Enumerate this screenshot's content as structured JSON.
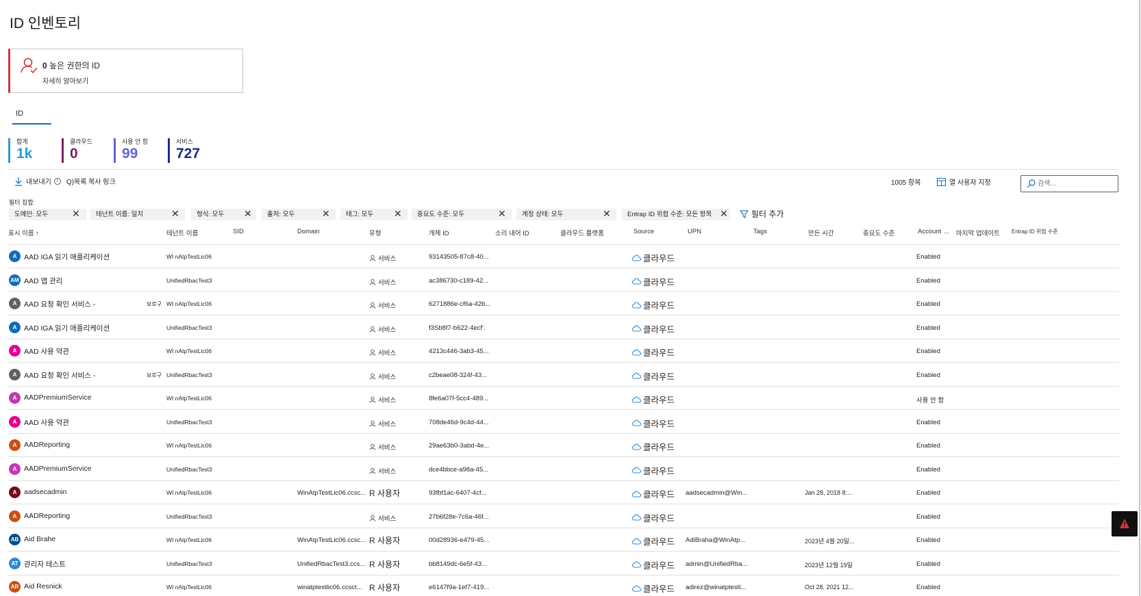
{
  "page": {
    "title": "ID 인벤토리"
  },
  "alert_card": {
    "count": "0",
    "title": "높은 권한의 ID",
    "link": "자세히 알아보기"
  },
  "tabs": [
    {
      "label": "ID"
    }
  ],
  "kpis": [
    {
      "label": "합계",
      "value": "1k",
      "color": "#2b9ad6"
    },
    {
      "label": "클라우드",
      "value": "0",
      "color": "#7a1f63"
    },
    {
      "label": "사용 안 함",
      "value": "99",
      "color": "#6264d8"
    },
    {
      "label": "서비스",
      "value": "727",
      "color": "#1d2a86"
    }
  ],
  "toolbar": {
    "export_label": "내보내기",
    "copy_label": "Q)목록 복사 링크",
    "count": "1005 항목",
    "customize_columns": "열 사용자 지정",
    "search_placeholder": "검색..."
  },
  "filters": {
    "label": "필터 집합:",
    "pills": [
      "도메인: 모두",
      "테넌트 이름: 일치",
      "형식: 모두",
      "출처: 모두",
      "태그: 모두",
      "중요도 수준: 모두",
      "계정 상태: 모두",
      "Entrap ID 위험 수준: 모든 항목"
    ],
    "add_label": "필터 추가"
  },
  "columns": [
    "표시 이름 ↑",
    "테넌트 이름",
    "SID",
    "Domain",
    "유형",
    "개체 ID",
    "소리 내어 ID",
    "클라우드 플랫폼",
    "Source",
    "UPN",
    "Tags",
    "만든 시간",
    "중요도 수준",
    "Account",
    "...",
    "마지막 업데이트",
    "Entrap ID 위험 수준"
  ],
  "rows": [
    {
      "initials": "A",
      "avatar_color": "#0f6cbd",
      "name": "AAD IGA 읽기 애플리케이션",
      "brand": "",
      "tenant": "WI nAtpTestLic06",
      "domain": "",
      "type": "서비스",
      "type_kind": "service",
      "objid": "93143505-87c8-40...",
      "source": "클라우드",
      "upn": "",
      "created": "",
      "account": "Enabled"
    },
    {
      "initials": "AM",
      "avatar_color": "#0f6cbd",
      "name": "AAD 앱 관리",
      "brand": "",
      "tenant": "UnifiedRbacTest3",
      "domain": "",
      "type": "서비스",
      "type_kind": "service",
      "objid": "ac386730-c189-42...",
      "source": "클라우드",
      "upn": "",
      "created": "",
      "account": "Enabled"
    },
    {
      "initials": "A",
      "avatar_color": "#616161",
      "name": "AAD 요청 확인 서비스 -",
      "brand": "보로구",
      "tenant": "WI nAtpTestLic06",
      "domain": "",
      "type": "서비스",
      "type_kind": "service",
      "objid": "6271886e-cf6a-42b...",
      "source": "클라우드",
      "upn": "",
      "created": "",
      "account": "Enabled"
    },
    {
      "initials": "A",
      "avatar_color": "#0f6cbd",
      "name": "AAD IGA 읽기 애플리케이션",
      "brand": "",
      "tenant": "UnifiedRbacTest3",
      "domain": "",
      "type": "서비스",
      "type_kind": "service",
      "objid": "f3Sb8f7-b622-4ecf'.",
      "source": "클라우드",
      "upn": "",
      "created": "",
      "account": "Enabled"
    },
    {
      "initials": "A",
      "avatar_color": "#e3008c",
      "name": "AAD 사용 약관",
      "brand": "",
      "tenant": "WI nAtpTestLic06",
      "domain": "",
      "type": "서비스",
      "type_kind": "service",
      "objid": "4213c446-3ab3-45...",
      "source": "클라우드",
      "upn": "",
      "created": "",
      "account": "Enabled"
    },
    {
      "initials": "A",
      "avatar_color": "#616161",
      "name": "AAD 요청 확인 서비스 -",
      "brand": "보로구",
      "tenant": "UnifiedRbacTest3",
      "domain": "",
      "type": "서비스",
      "type_kind": "service",
      "objid": "c2beae08-324f-43...",
      "source": "클라우드",
      "upn": "",
      "created": "",
      "account": "Enabled"
    },
    {
      "initials": "A",
      "avatar_color": "#c239b3",
      "name": "AADPremiumService",
      "brand": "",
      "tenant": "WI nAtpTestLic06",
      "domain": "",
      "type": "서비스",
      "type_kind": "service",
      "objid": "8fe6a07f-5cc4-489...",
      "source": "클라우드",
      "upn": "",
      "created": "",
      "account": "사용 안 함"
    },
    {
      "initials": "A",
      "avatar_color": "#e3008c",
      "name": "AAD 사용 약관",
      "brand": "",
      "tenant": "UnifiedRbacTest3",
      "domain": "",
      "type": "서비스",
      "type_kind": "service",
      "objid": "708de46d-9c4d-44...",
      "source": "클라우드",
      "upn": "",
      "created": "",
      "account": "Enabled"
    },
    {
      "initials": "A",
      "avatar_color": "#ca5010",
      "name": "AADReporting",
      "brand": "",
      "tenant": "WI nAtpTestLic06",
      "domain": "",
      "type": "서비스",
      "type_kind": "service",
      "objid": "29ae63b0-3abd-4e...",
      "source": "클라우드",
      "upn": "",
      "created": "",
      "account": "Enabled"
    },
    {
      "initials": "A",
      "avatar_color": "#c239b3",
      "name": "AADPremiumService",
      "brand": "",
      "tenant": "UnifiedRbacTest3",
      "domain": "",
      "type": "서비스",
      "type_kind": "service",
      "objid": "dce4bbce-a98a-45...",
      "source": "클라우드",
      "upn": "",
      "created": "",
      "account": "Enabled"
    },
    {
      "initials": "A",
      "avatar_color": "#750b1c",
      "name": "aadsecadmin",
      "brand": "",
      "tenant": "WI nAtpTestLic06",
      "domain": "WinAtpTestLic06.ccsc...",
      "type": "R 사용자",
      "type_kind": "user",
      "objid": "93fbf1ac-6407-4cf...",
      "source": "클라우드",
      "upn": "aadsecadmin@Win...",
      "created": "Jan 28, 2018 8:...",
      "account": "Enabled"
    },
    {
      "initials": "A",
      "avatar_color": "#ca5010",
      "name": "AADReporting",
      "brand": "",
      "tenant": "UnifiedRbacTest3",
      "domain": "",
      "type": "서비스",
      "type_kind": "service",
      "objid": "27b6f28e-7c6a-46f...",
      "source": "클라우드",
      "upn": "",
      "created": "",
      "account": "Enabled"
    },
    {
      "initials": "AB",
      "avatar_color": "#004e8c",
      "name": "Aid Brahe",
      "brand": "",
      "tenant": "WI nAtpTestLic06",
      "domain": "WinAtpTestLic06.ccsc...",
      "type": "R 사용자",
      "type_kind": "user",
      "objid": "00d28936-e479-45...",
      "source": "클라우드",
      "upn": "AdiBraha@WinAtp...",
      "created": "2023년 4월 20일...",
      "account": "Enabled"
    },
    {
      "initials": "AT",
      "avatar_color": "#2b88d8",
      "name": "관리자 테스트",
      "brand": "",
      "tenant": "UnifiedRbacTest3",
      "domain": "UnifiedRbacTest3.ccs...",
      "type": "R 사용자",
      "type_kind": "user",
      "objid": "bb8149dc-6e5f-43...",
      "source": "클라우드",
      "upn": "admin@UnifiedRba...",
      "created": "2023년 12월 19일",
      "account": "Enabled"
    },
    {
      "initials": "AR",
      "avatar_color": "#ca5010",
      "name": "Aid Resnick",
      "brand": "",
      "tenant": "WI nAtpTestLic06",
      "domain": "winatptestlic06.ccsct...",
      "type": "R 사용자",
      "type_kind": "user",
      "objid": "e6147f9a-1ef7-419...",
      "source": "클라우드",
      "upn": "adirez@winatptestl...",
      "created": "Oct 28, 2021 12...",
      "account": "Enabled"
    }
  ]
}
